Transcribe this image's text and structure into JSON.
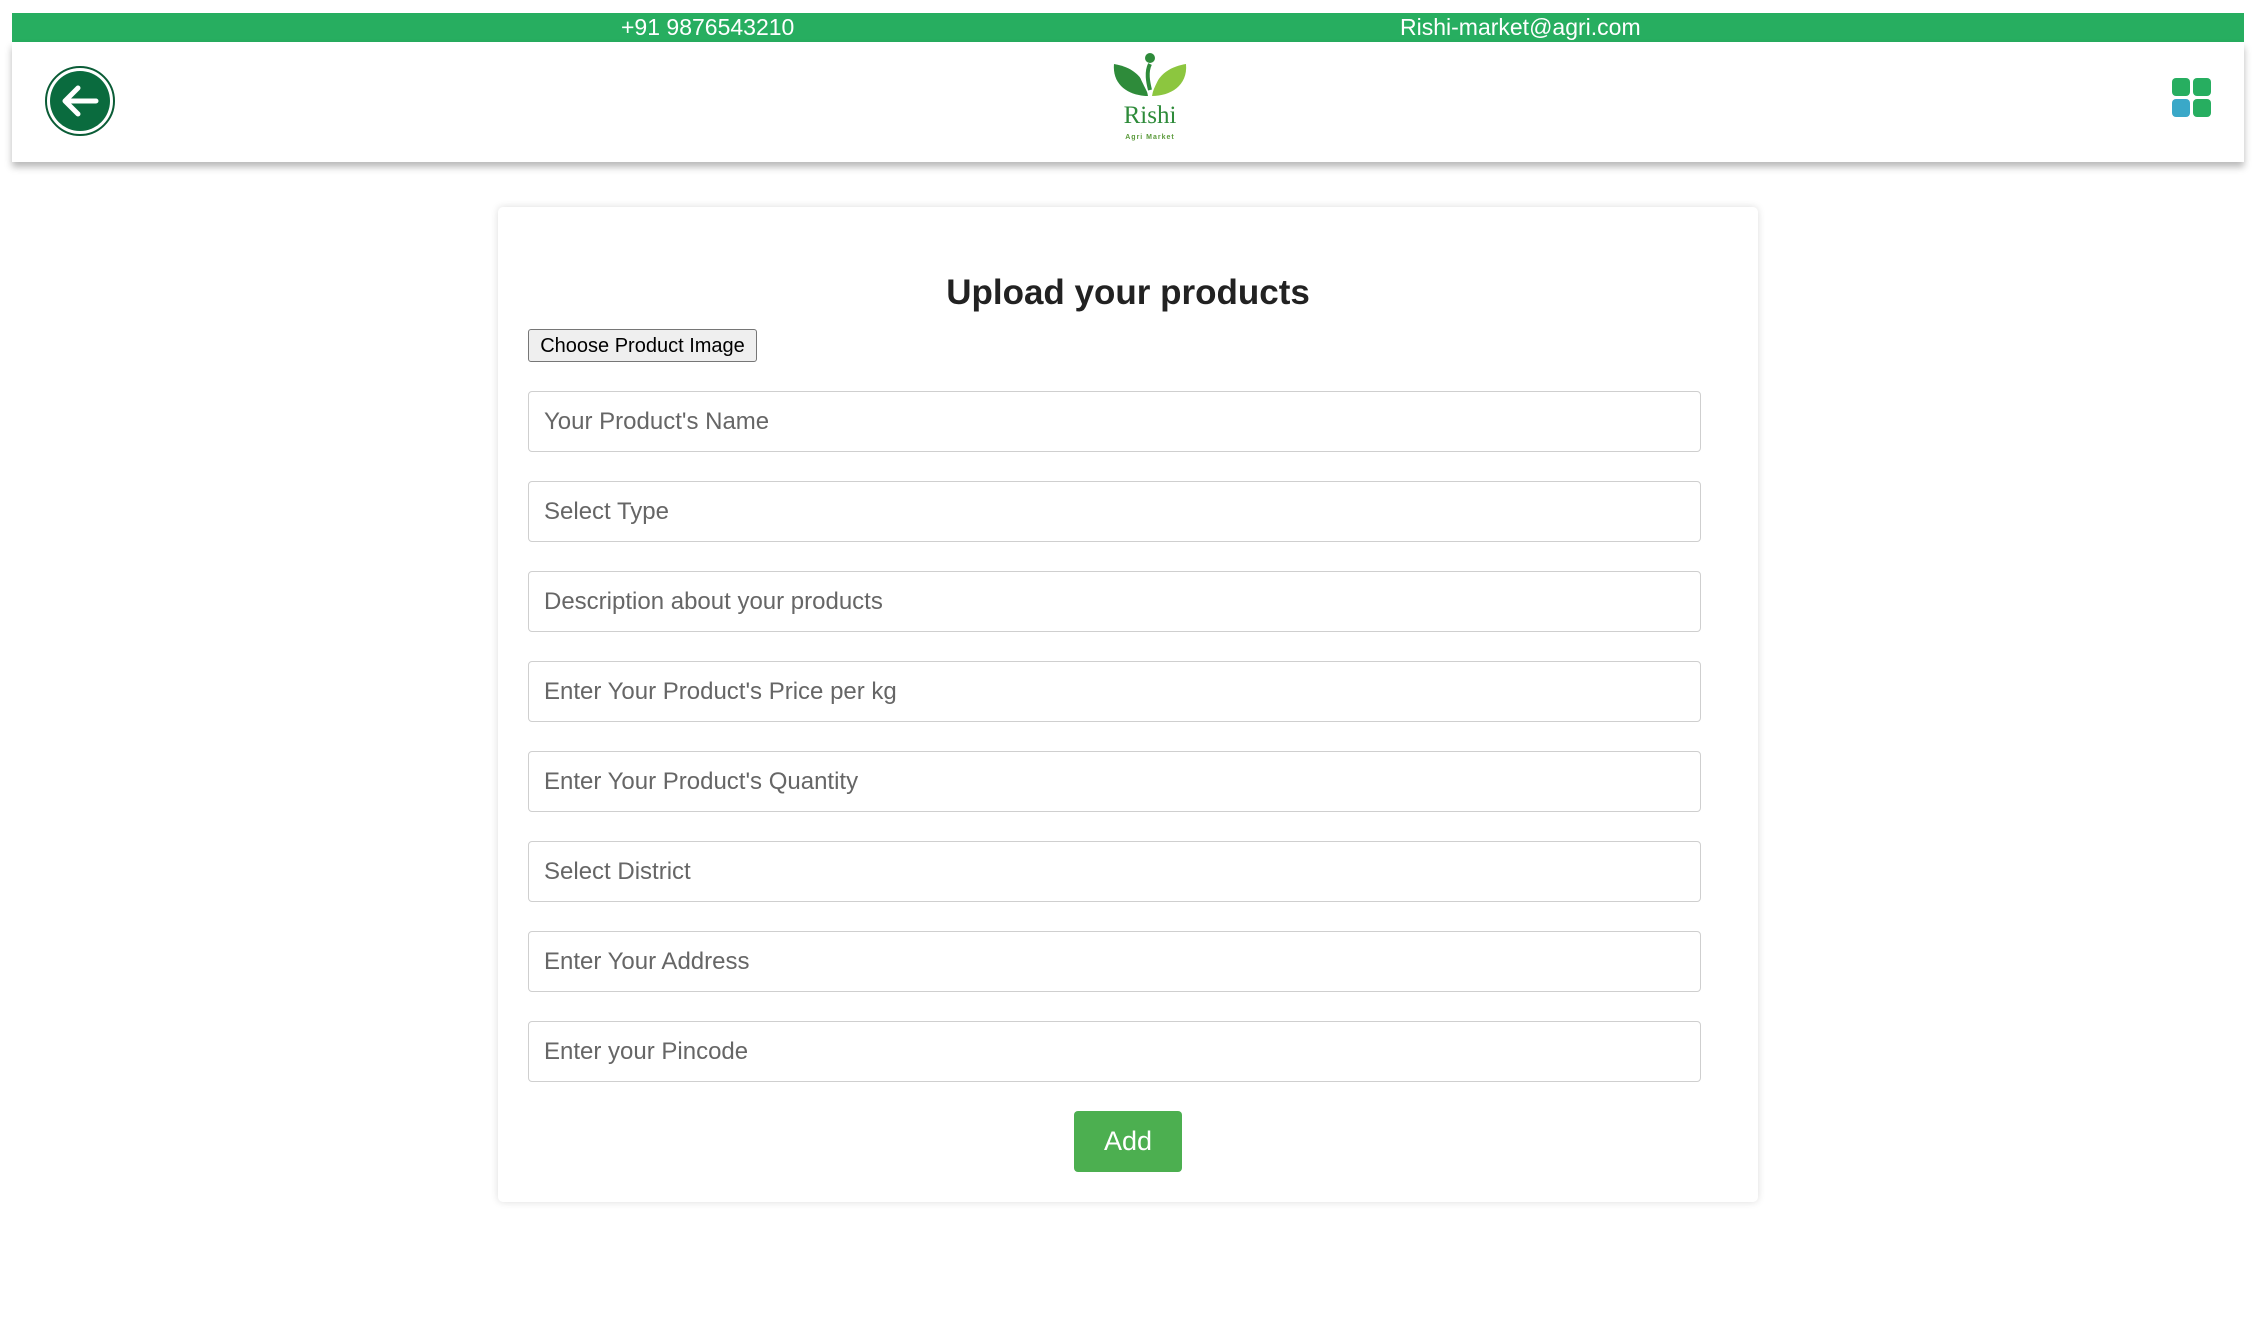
{
  "topbar": {
    "phone": "+91 9876543210",
    "email": "Rishi-market@agri.com",
    "color": "#27ae60"
  },
  "header": {
    "back_icon": "arrow-left-circle-icon",
    "logo": {
      "name": "Rishi",
      "tagline": "Agri Market"
    },
    "menu_icon": "grid-menu-icon",
    "menu_colors": [
      "#27ae60",
      "#3aa8c8"
    ]
  },
  "form": {
    "title": "Upload your products",
    "image_button": "Choose Product Image",
    "fields": [
      {
        "placeholder": "Your Product's Name",
        "value": ""
      },
      {
        "placeholder": "Select Type",
        "value": ""
      },
      {
        "placeholder": "Description about your products",
        "value": ""
      },
      {
        "placeholder": "Enter Your Product's Price per kg",
        "value": ""
      },
      {
        "placeholder": "Enter Your Product's Quantity",
        "value": ""
      },
      {
        "placeholder": "Select District",
        "value": ""
      },
      {
        "placeholder": "Enter Your Address",
        "value": ""
      },
      {
        "placeholder": "Enter your Pincode",
        "value": ""
      }
    ],
    "submit_label": "Add",
    "submit_color": "#4caf50"
  }
}
